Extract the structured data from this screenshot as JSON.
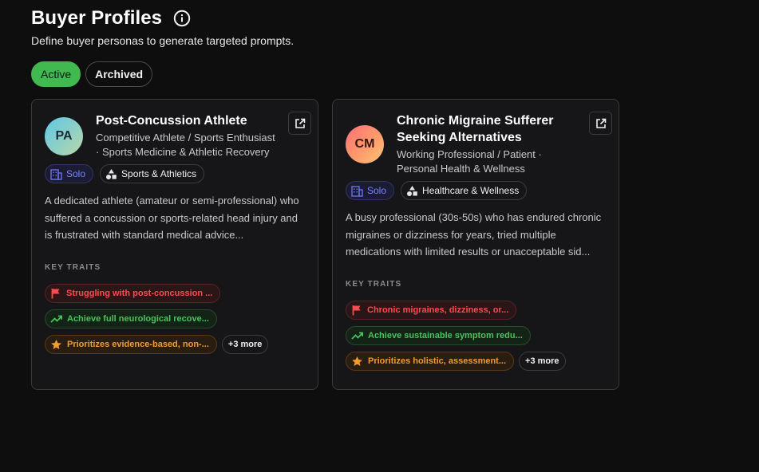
{
  "header": {
    "title": "Buyer Profiles",
    "subtitle": "Define buyer personas to generate targeted prompts."
  },
  "filters": {
    "active_label": "Active",
    "archived_label": "Archived"
  },
  "colors": {
    "accent_green": "#3fb950",
    "solo_blue": "#7a84ff",
    "trait_red": "#ff4a4f",
    "trait_green": "#46c35a",
    "trait_orange": "#f29b2f"
  },
  "cards": [
    {
      "initials": "PA",
      "title": "Post-Concussion Athlete",
      "subtitle": "Competitive Athlete / Sports Enthusiast · Sports Medicine & Athletic Recovery",
      "solo_label": "Solo",
      "category_label": "Sports & Athletics",
      "description": "A dedicated athlete (amateur or semi-professional) who suffered a concussion or sports-related head injury and is frustrated with standard medical advice...",
      "key_traits_label": "KEY TRAITS",
      "traits": {
        "pain": "Struggling with post-concussion ...",
        "goal": "Achieve full neurological recove...",
        "priority": "Prioritizes evidence-based, non-..."
      },
      "more_label": "+3 more"
    },
    {
      "initials": "CM",
      "title": "Chronic Migraine Sufferer Seeking Alternatives",
      "subtitle": "Working Professional / Patient · Personal Health & Wellness",
      "solo_label": "Solo",
      "category_label": "Healthcare & Wellness",
      "description": "A busy professional (30s-50s) who has endured chronic migraines or dizziness for years, tried multiple medications with limited results or unacceptable sid...",
      "key_traits_label": "KEY TRAITS",
      "traits": {
        "pain": "Chronic migraines, dizziness, or...",
        "goal": "Achieve sustainable symptom redu...",
        "priority": "Prioritizes holistic, assessment..."
      },
      "more_label": "+3 more"
    }
  ],
  "icons": {
    "info": "info-circle-icon",
    "open": "external-link-icon",
    "solo": "building-icon",
    "category": "shapes-icon",
    "pain": "flag-icon",
    "goal": "trending-up-icon",
    "priority": "star-icon"
  }
}
